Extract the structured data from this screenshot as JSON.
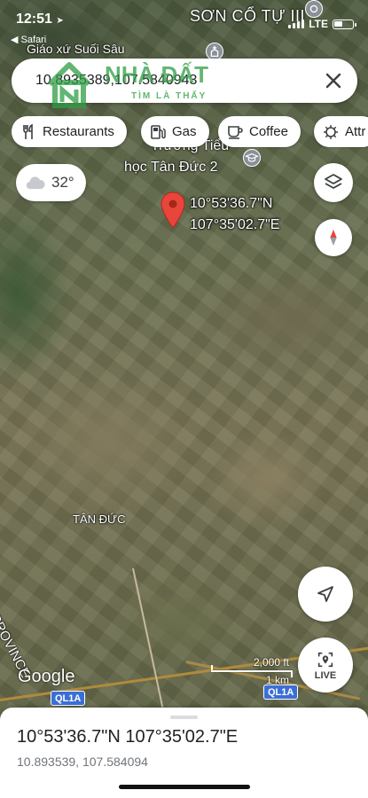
{
  "status_bar": {
    "time": "12:51",
    "back_app": "◀ Safari",
    "network": "LTE"
  },
  "search": {
    "query": "10.8935389,107.5840943",
    "clear_icon": "close-icon"
  },
  "watermark": {
    "brand": "NHÀ ĐẤT",
    "sub": "TÌM LÀ THẤY"
  },
  "chips": [
    {
      "label": "Restaurants",
      "icon": "fork-knife-icon"
    },
    {
      "label": "Gas",
      "icon": "gas-pump-icon"
    },
    {
      "label": "Coffee",
      "icon": "coffee-cup-icon"
    },
    {
      "label": "Attr",
      "icon": "attractions-icon"
    }
  ],
  "weather": {
    "temperature": "32°",
    "icon": "cloud-icon"
  },
  "map": {
    "labels": {
      "son_co_tu": "SƠN CỔ TỰ III",
      "giao_xu": "Giáo xứ Suối Sâu",
      "school_line1": "Trường Tiểu",
      "school_line2": "học Tân Đức 2",
      "tan_duc": "TÂN ĐỨC",
      "province": "PROVINCE"
    },
    "pin_label": {
      "lat": "10°53'36.7\"N",
      "lng": "107°35'02.7\"E"
    },
    "road_shield": "QL1A",
    "road_shield_2": "QL1A",
    "google_logo": "Google",
    "scale": {
      "imperial": "2,000 ft",
      "metric": "1 km"
    },
    "live_label": "LIVE"
  },
  "colors": {
    "pin": "#e8453c",
    "compass_red": "#e8453c",
    "shield_blue": "#3b6fd8"
  },
  "sheet": {
    "title": "10°53'36.7\"N 107°35'02.7\"E",
    "subtitle": "10.893539, 107.584094"
  }
}
